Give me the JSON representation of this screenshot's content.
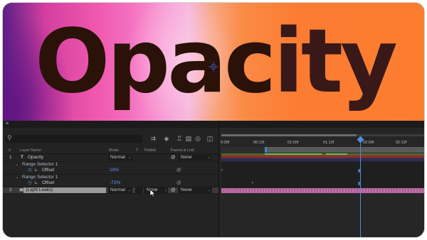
{
  "preview": {
    "title": "Opacity",
    "title_main": "Opac",
    "title_tail": "ity",
    "colors": [
      "#5b1f86",
      "#ee58ad",
      "#f5b6dc",
      "#fc7c32"
    ]
  },
  "panel": {
    "menu_icon": "≡",
    "search_placeholder": "",
    "toolbar_icons": [
      "composition-flowchart-icon",
      "draft-3d-icon",
      "shy-layers-icon",
      "frame-blending-icon",
      "motion-blur-icon",
      "graph-editor-icon"
    ]
  },
  "columns": {
    "num": "#",
    "layer_name": "Layer Name",
    "mode": "Mode",
    "t": "T",
    "trkmat": "TrkMat",
    "parent_link": "Parent & Link"
  },
  "layers": [
    {
      "num": "1",
      "type_icon": "T",
      "name": "Opacity",
      "mode": "Normal",
      "parent": "None",
      "range_selectors": [
        {
          "label": "Range Selector 1",
          "property": "Offset",
          "value": "10%"
        },
        {
          "label": "Range Selector 1",
          "property": "Offset",
          "value": "-72%"
        }
      ]
    },
    {
      "num": "2",
      "name": "[Light Leaks]",
      "mode": "Normal",
      "trkmat": "None",
      "parent": "None"
    }
  ],
  "timeline": {
    "ticks": [
      "0:00f",
      "00:12f",
      "01:00f",
      "01:12f",
      "02:00f",
      "02:12f"
    ],
    "playhead_time": "02:00f"
  }
}
